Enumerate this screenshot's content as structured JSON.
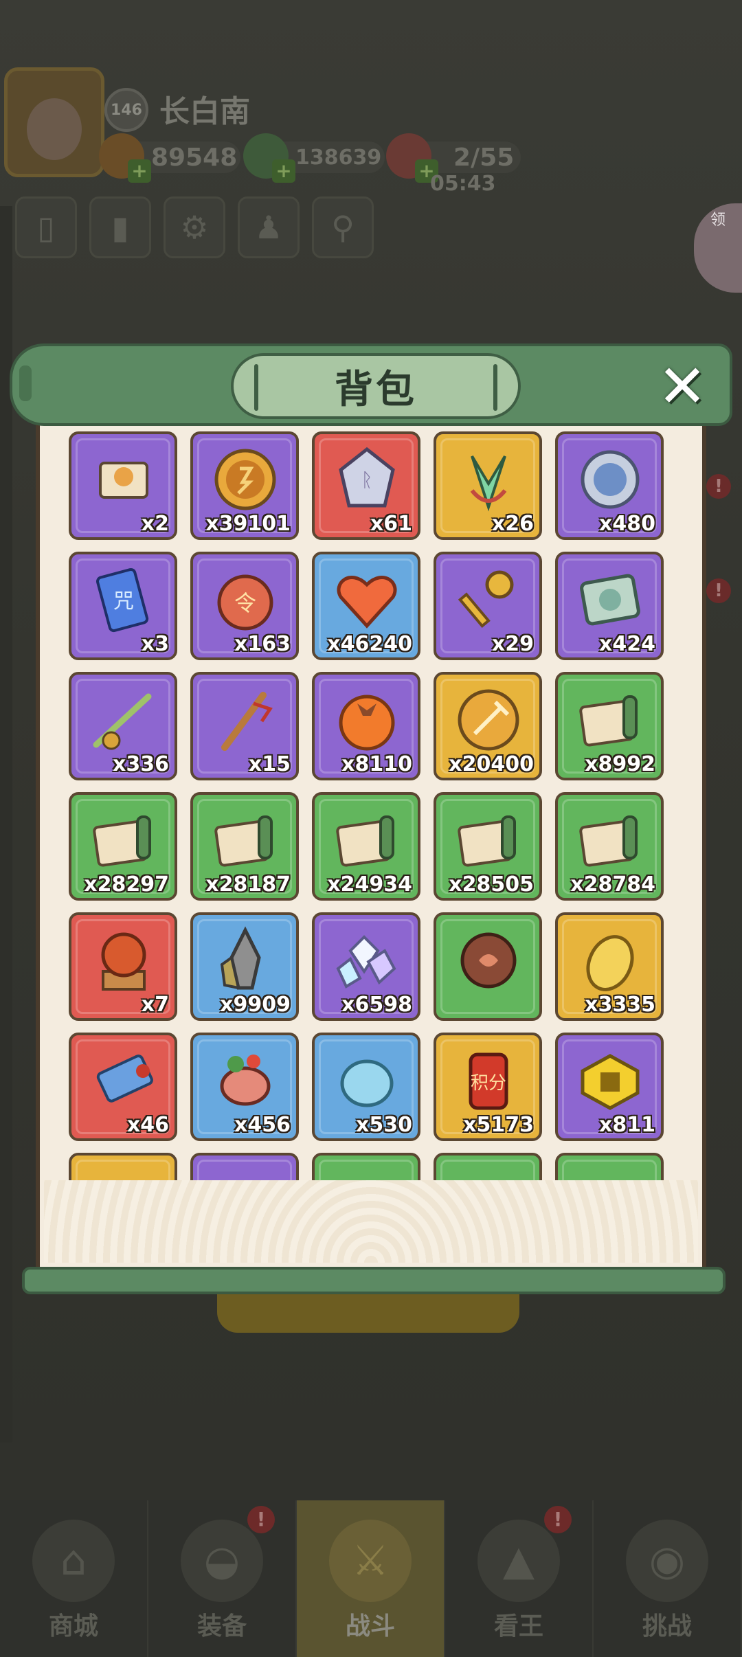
{
  "player": {
    "level": "146",
    "name": "长白南",
    "gold": "89548",
    "jade": "138639",
    "stamina": "2/55",
    "stamina_timer": "05:43"
  },
  "side_gift": {
    "label": "领"
  },
  "bag": {
    "title": "背包",
    "close_label": "✕",
    "items": [
      {
        "icon": "scroll-icon",
        "rarity": "purple",
        "qty": "x2"
      },
      {
        "icon": "gold-coin-icon",
        "rarity": "purple",
        "qty": "x39101"
      },
      {
        "icon": "rune-stone-icon",
        "rarity": "red",
        "qty": "x61"
      },
      {
        "icon": "jade-feather-icon",
        "rarity": "gold",
        "qty": "x26"
      },
      {
        "icon": "silver-badge-icon",
        "rarity": "purple",
        "qty": "x480"
      },
      {
        "icon": "talisman-icon",
        "rarity": "purple",
        "qty": "x3"
      },
      {
        "icon": "order-token-icon",
        "rarity": "purple",
        "qty": "x163"
      },
      {
        "icon": "heart-icon",
        "rarity": "blue",
        "qty": "x46240"
      },
      {
        "icon": "key-icon",
        "rarity": "purple",
        "qty": "x29"
      },
      {
        "icon": "compass-book-icon",
        "rarity": "purple",
        "qty": "x424"
      },
      {
        "icon": "fishing-rod-icon",
        "rarity": "purple",
        "qty": "x336"
      },
      {
        "icon": "staff-icon",
        "rarity": "purple",
        "qty": "x15"
      },
      {
        "icon": "persimmon-icon",
        "rarity": "purple",
        "qty": "x8110"
      },
      {
        "icon": "axe-coin-icon",
        "rarity": "gold",
        "qty": "x20400"
      },
      {
        "icon": "green-scroll-icon",
        "rarity": "green",
        "qty": "x8992"
      },
      {
        "icon": "green-scroll-icon",
        "rarity": "green",
        "qty": "x28297"
      },
      {
        "icon": "green-scroll-icon",
        "rarity": "green",
        "qty": "x28187"
      },
      {
        "icon": "green-scroll-icon",
        "rarity": "green",
        "qty": "x24934"
      },
      {
        "icon": "green-scroll-icon",
        "rarity": "green",
        "qty": "x28505"
      },
      {
        "icon": "green-scroll-icon",
        "rarity": "green",
        "qty": "x28784"
      },
      {
        "icon": "crystal-ball-icon",
        "rarity": "red",
        "qty": "x7"
      },
      {
        "icon": "ore-crystal-icon",
        "rarity": "blue",
        "qty": "x9909"
      },
      {
        "icon": "gem-cluster-icon",
        "rarity": "purple",
        "qty": "x6598"
      },
      {
        "icon": "spirit-orb-icon",
        "rarity": "green",
        "qty": ""
      },
      {
        "icon": "dragon-scale-icon",
        "rarity": "gold",
        "qty": "x3335"
      },
      {
        "icon": "charm-scroll-icon",
        "rarity": "red",
        "qty": "x46"
      },
      {
        "icon": "meat-icon",
        "rarity": "blue",
        "qty": "x456"
      },
      {
        "icon": "water-drop-icon",
        "rarity": "blue",
        "qty": "x530"
      },
      {
        "icon": "points-badge-icon",
        "rarity": "gold",
        "qty": "x5173"
      },
      {
        "icon": "gold-block-icon",
        "rarity": "purple",
        "qty": "x811"
      },
      {
        "icon": "item-icon",
        "rarity": "gold",
        "qty": ""
      },
      {
        "icon": "item-icon",
        "rarity": "purple",
        "qty": ""
      },
      {
        "icon": "item-icon",
        "rarity": "green",
        "qty": ""
      },
      {
        "icon": "item-icon",
        "rarity": "green",
        "qty": ""
      },
      {
        "icon": "item-icon",
        "rarity": "green",
        "qty": ""
      }
    ]
  },
  "nav": [
    {
      "label": "商城",
      "icon": "shop-icon",
      "alert": ""
    },
    {
      "label": "装备",
      "icon": "helmet-icon",
      "alert": "!"
    },
    {
      "label": "战斗",
      "icon": "crossed-swords-icon",
      "alert": "",
      "active": true
    },
    {
      "label": "看王",
      "icon": "mountain-icon",
      "alert": "!"
    },
    {
      "label": "挑战",
      "icon": "challenge-icon",
      "alert": ""
    }
  ],
  "colors": {
    "purple": "#8d66d0",
    "blue": "#68a9df",
    "red": "#e05a52",
    "gold": "#e7b43c",
    "green": "#62b65d",
    "scroll_green": "#5c8a63",
    "paper": "#f4ecdf"
  }
}
